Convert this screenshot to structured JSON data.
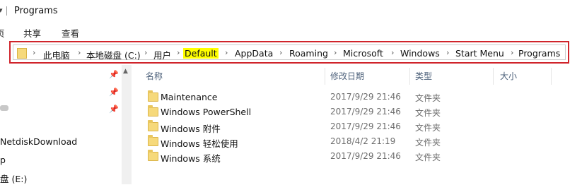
{
  "window": {
    "title": "Programs"
  },
  "ribbon": {
    "tabs": [
      "页",
      "共享",
      "查看"
    ]
  },
  "address": {
    "crumbs": [
      "此电脑",
      "本地磁盘 (C:)",
      "用户",
      "Default",
      "AppData",
      "Roaming",
      "Microsoft",
      "Windows",
      "Start Menu",
      "Programs"
    ],
    "highlighted": "Default",
    "highlight_color": "#ffff00",
    "frame_color": "#d0242b"
  },
  "nav": {
    "items": [
      "NetdiskDownload",
      "p",
      "盘 (E:)"
    ]
  },
  "columns": {
    "name": "名称",
    "modified": "修改日期",
    "type": "类型",
    "size": "大小"
  },
  "files": [
    {
      "name": "Maintenance",
      "modified": "2017/9/29 21:46",
      "type": "文件夹"
    },
    {
      "name": "Windows PowerShell",
      "modified": "2017/9/29 21:46",
      "type": "文件夹"
    },
    {
      "name": "Windows 附件",
      "modified": "2017/9/29 21:46",
      "type": "文件夹"
    },
    {
      "name": "Windows 轻松使用",
      "modified": "2018/4/2 21:19",
      "type": "文件夹"
    },
    {
      "name": "Windows 系统",
      "modified": "2017/9/29 21:46",
      "type": "文件夹"
    }
  ]
}
